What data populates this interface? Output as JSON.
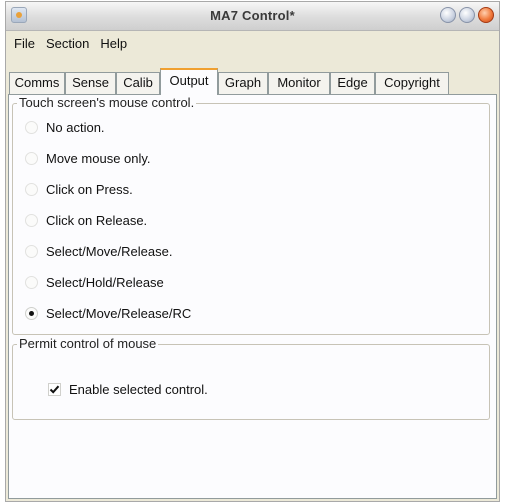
{
  "window": {
    "title": "MA7 Control*"
  },
  "menu": [
    "File",
    "Section",
    "Help"
  ],
  "tabs": [
    {
      "label": "Comms",
      "active": false
    },
    {
      "label": "Sense",
      "active": false
    },
    {
      "label": "Calib",
      "active": false
    },
    {
      "label": "Output",
      "active": true
    },
    {
      "label": "Graph",
      "active": false
    },
    {
      "label": "Monitor",
      "active": false
    },
    {
      "label": "Edge",
      "active": false
    },
    {
      "label": "Copyright",
      "active": false
    }
  ],
  "mouse_control_group": {
    "legend": "Touch screen's mouse control.",
    "options": [
      {
        "label": "No action.",
        "selected": false
      },
      {
        "label": "Move mouse only.",
        "selected": false
      },
      {
        "label": "Click on Press.",
        "selected": false
      },
      {
        "label": "Click on Release.",
        "selected": false
      },
      {
        "label": "Select/Move/Release.",
        "selected": false
      },
      {
        "label": "Select/Hold/Release",
        "selected": false
      },
      {
        "label": "Select/Move/Release/RC",
        "selected": true
      }
    ]
  },
  "permit_group": {
    "legend": "Permit control of mouse",
    "checkbox_label": "Enable selected control.",
    "checked": true
  }
}
